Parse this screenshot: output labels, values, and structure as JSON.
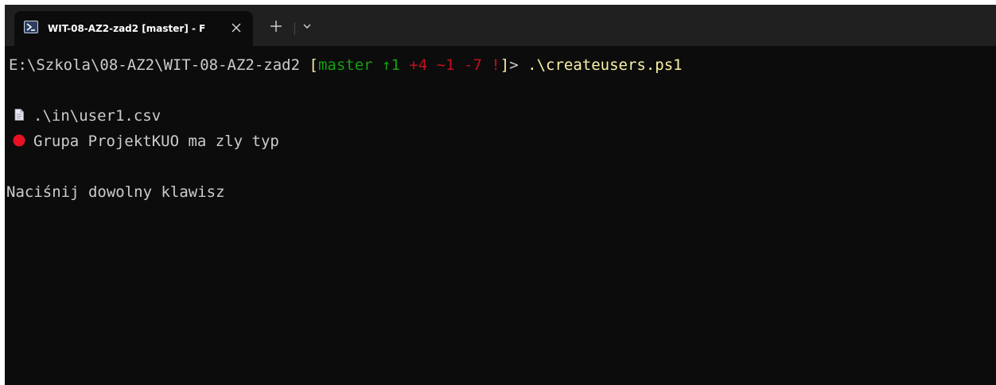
{
  "tab": {
    "title": "WIT-08-AZ2-zad2 [master] - F",
    "icon": "powershell-icon",
    "close_icon": "close-icon",
    "new_tab_icon": "plus-icon",
    "dropdown_icon": "chevron-down-icon"
  },
  "terminal": {
    "prompt": {
      "path": "E:\\Szkola\\08-AZ2\\WIT-08-AZ2-zad2 ",
      "open_bracket": "[",
      "branch": "master",
      "ahead": " ↑1",
      "added": " +4",
      "modified": " ~1",
      "deleted": " -7",
      "bang": " !",
      "close": "]",
      "gt": "> ",
      "command": ".\\createusers.ps1"
    },
    "output": {
      "file_icon": "document-icon",
      "file_text": ".\\in\\user1.csv",
      "error_icon": "red-circle-icon",
      "error_text": "Grupa ProjektKUO ma zly typ",
      "keypress_text": "Naciśnij dowolny klawisz"
    }
  },
  "colors": {
    "background": "#0c0c0c",
    "tabbar": "#202020",
    "text": "#cccccc",
    "yellow": "#f9f1a5",
    "green": "#13a10e",
    "red": "#c50f1f",
    "error_dot": "#e81123"
  }
}
